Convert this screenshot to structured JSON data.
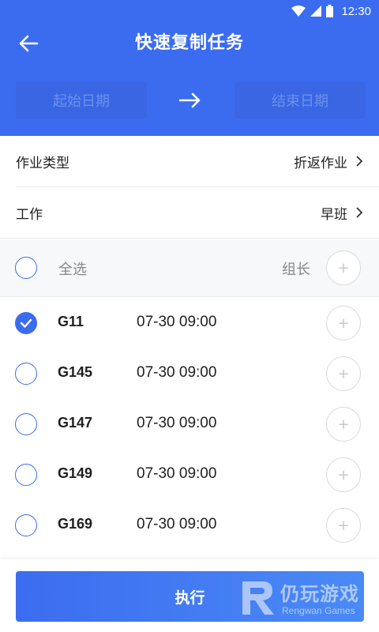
{
  "status_bar": {
    "time": "12:30",
    "icons": [
      "wifi-icon",
      "signal-icon",
      "battery-icon"
    ]
  },
  "header": {
    "title": "快速复制任务",
    "start_date_placeholder": "起始日期",
    "end_date_placeholder": "结束日期"
  },
  "settings": {
    "job_type": {
      "label": "作业类型",
      "value": "折返作业"
    },
    "work": {
      "label": "工作",
      "value": "早班"
    }
  },
  "select_all": {
    "label": "全选",
    "leader_label": "组长",
    "checked": false
  },
  "trains": [
    {
      "code": "G11",
      "time": "07-30 09:00",
      "checked": true
    },
    {
      "code": "G145",
      "time": "07-30 09:00",
      "checked": false
    },
    {
      "code": "G147",
      "time": "07-30 09:00",
      "checked": false
    },
    {
      "code": "G149",
      "time": "07-30 09:00",
      "checked": false
    },
    {
      "code": "G169",
      "time": "07-30 09:00",
      "checked": false
    }
  ],
  "add_symbol": "+",
  "footer": {
    "execute_label": "执行"
  },
  "watermark": {
    "text_cn": "仍玩游戏",
    "text_en": "Rengwan Games"
  },
  "colors": {
    "primary": "#3b6cf0",
    "date_box": "#3a66e3",
    "date_placeholder": "#6b90ef"
  }
}
